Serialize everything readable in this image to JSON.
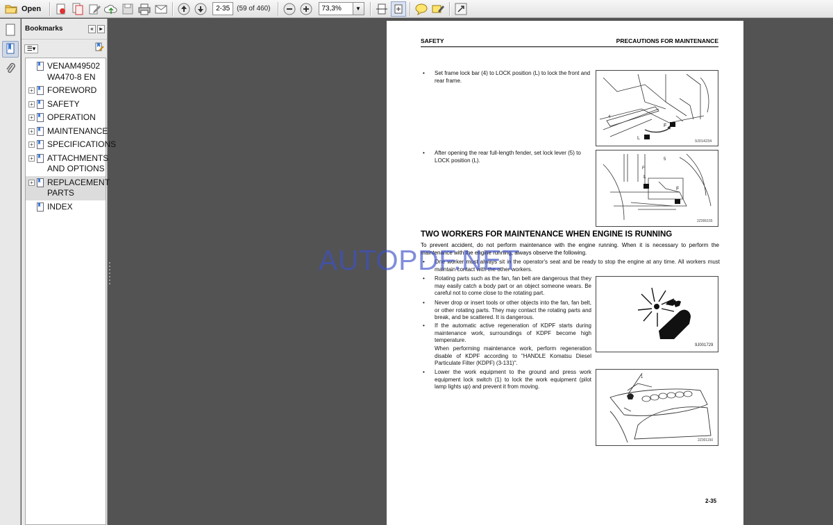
{
  "toolbar": {
    "open_label": "Open",
    "page_value": "2-35",
    "page_count": "(59 of 460)",
    "zoom_value": "73,3%"
  },
  "sidebar": {
    "title": "Bookmarks",
    "items": [
      {
        "label": "VENAM49502 WA470-8 EN",
        "expandable": false
      },
      {
        "label": "FOREWORD",
        "expandable": true
      },
      {
        "label": "SAFETY",
        "expandable": true
      },
      {
        "label": "OPERATION",
        "expandable": true
      },
      {
        "label": "MAINTENANCE",
        "expandable": true
      },
      {
        "label": "SPECIFICATIONS",
        "expandable": true
      },
      {
        "label": "ATTACHMENTS AND OPTIONS",
        "expandable": true
      },
      {
        "label": "REPLACEMENT PARTS",
        "expandable": true,
        "selected": true
      },
      {
        "label": "INDEX",
        "expandable": false
      }
    ]
  },
  "document": {
    "header_left": "SAFETY",
    "header_right": "PRECAUTIONS FOR MAINTENANCE",
    "bullet1": "Set frame lock bar (4) to LOCK position (L) to lock the front and rear frame.",
    "bullet2": "After opening the rear full-length fender, set lock lever (5) to LOCK position (L).",
    "section_title": "TWO WORKERS FOR MAINTENANCE WHEN ENGINE IS RUNNING",
    "intro": "To prevent accident, do not perform maintenance with the engine running. When it is necessary to perform the maintenance with the engine running, always observe the following.",
    "bullet3": "One worker must always sit in the operator's seat and be ready to stop the engine at any time. All workers must maintain contact with the other workers.",
    "bullet4": "Rotating parts such as the fan, fan belt are dangerous that they may easily catch a body part or an object someone wears. Be careful not to come close to the rotating part.",
    "bullet5": "Never drop or insert tools or other objects into the fan, fan belt, or other rotating parts. They may contact the rotating parts and break, and be scattered. It is dangerous.",
    "bullet6a": "If the automatic active regeneration of KDPF starts during maintenance work, surroundings of KDPF become high temperature.",
    "bullet6b": "When performing maintenance work, perform regeneration disable of KDPF according to \"HANDLE Komatsu Diesel Particulate Filter (KDPF) (3-131)\".",
    "bullet7": "Lower the work equipment to the ground and press work equipment lock switch (1) to lock the work equipment (pilot lamp lights up) and prevent it from moving.",
    "fig1_code": "9J014234",
    "fig2_code": "2Z006155",
    "fig3_code": "9J001729",
    "fig4_code": "2Z001150",
    "page_number": "2-35",
    "watermark": "AUTOPDF.NET"
  }
}
